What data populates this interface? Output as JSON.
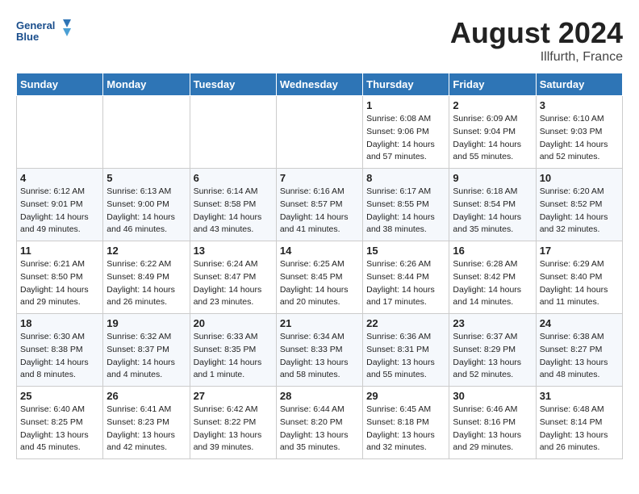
{
  "header": {
    "logo_line1": "General",
    "logo_line2": "Blue",
    "month": "August 2024",
    "location": "Illfurth, France"
  },
  "days_of_week": [
    "Sunday",
    "Monday",
    "Tuesday",
    "Wednesday",
    "Thursday",
    "Friday",
    "Saturday"
  ],
  "weeks": [
    [
      {
        "day": "",
        "info": ""
      },
      {
        "day": "",
        "info": ""
      },
      {
        "day": "",
        "info": ""
      },
      {
        "day": "",
        "info": ""
      },
      {
        "day": "1",
        "info": "Sunrise: 6:08 AM\nSunset: 9:06 PM\nDaylight: 14 hours\nand 57 minutes."
      },
      {
        "day": "2",
        "info": "Sunrise: 6:09 AM\nSunset: 9:04 PM\nDaylight: 14 hours\nand 55 minutes."
      },
      {
        "day": "3",
        "info": "Sunrise: 6:10 AM\nSunset: 9:03 PM\nDaylight: 14 hours\nand 52 minutes."
      }
    ],
    [
      {
        "day": "4",
        "info": "Sunrise: 6:12 AM\nSunset: 9:01 PM\nDaylight: 14 hours\nand 49 minutes."
      },
      {
        "day": "5",
        "info": "Sunrise: 6:13 AM\nSunset: 9:00 PM\nDaylight: 14 hours\nand 46 minutes."
      },
      {
        "day": "6",
        "info": "Sunrise: 6:14 AM\nSunset: 8:58 PM\nDaylight: 14 hours\nand 43 minutes."
      },
      {
        "day": "7",
        "info": "Sunrise: 6:16 AM\nSunset: 8:57 PM\nDaylight: 14 hours\nand 41 minutes."
      },
      {
        "day": "8",
        "info": "Sunrise: 6:17 AM\nSunset: 8:55 PM\nDaylight: 14 hours\nand 38 minutes."
      },
      {
        "day": "9",
        "info": "Sunrise: 6:18 AM\nSunset: 8:54 PM\nDaylight: 14 hours\nand 35 minutes."
      },
      {
        "day": "10",
        "info": "Sunrise: 6:20 AM\nSunset: 8:52 PM\nDaylight: 14 hours\nand 32 minutes."
      }
    ],
    [
      {
        "day": "11",
        "info": "Sunrise: 6:21 AM\nSunset: 8:50 PM\nDaylight: 14 hours\nand 29 minutes."
      },
      {
        "day": "12",
        "info": "Sunrise: 6:22 AM\nSunset: 8:49 PM\nDaylight: 14 hours\nand 26 minutes."
      },
      {
        "day": "13",
        "info": "Sunrise: 6:24 AM\nSunset: 8:47 PM\nDaylight: 14 hours\nand 23 minutes."
      },
      {
        "day": "14",
        "info": "Sunrise: 6:25 AM\nSunset: 8:45 PM\nDaylight: 14 hours\nand 20 minutes."
      },
      {
        "day": "15",
        "info": "Sunrise: 6:26 AM\nSunset: 8:44 PM\nDaylight: 14 hours\nand 17 minutes."
      },
      {
        "day": "16",
        "info": "Sunrise: 6:28 AM\nSunset: 8:42 PM\nDaylight: 14 hours\nand 14 minutes."
      },
      {
        "day": "17",
        "info": "Sunrise: 6:29 AM\nSunset: 8:40 PM\nDaylight: 14 hours\nand 11 minutes."
      }
    ],
    [
      {
        "day": "18",
        "info": "Sunrise: 6:30 AM\nSunset: 8:38 PM\nDaylight: 14 hours\nand 8 minutes."
      },
      {
        "day": "19",
        "info": "Sunrise: 6:32 AM\nSunset: 8:37 PM\nDaylight: 14 hours\nand 4 minutes."
      },
      {
        "day": "20",
        "info": "Sunrise: 6:33 AM\nSunset: 8:35 PM\nDaylight: 14 hours\nand 1 minute."
      },
      {
        "day": "21",
        "info": "Sunrise: 6:34 AM\nSunset: 8:33 PM\nDaylight: 13 hours\nand 58 minutes."
      },
      {
        "day": "22",
        "info": "Sunrise: 6:36 AM\nSunset: 8:31 PM\nDaylight: 13 hours\nand 55 minutes."
      },
      {
        "day": "23",
        "info": "Sunrise: 6:37 AM\nSunset: 8:29 PM\nDaylight: 13 hours\nand 52 minutes."
      },
      {
        "day": "24",
        "info": "Sunrise: 6:38 AM\nSunset: 8:27 PM\nDaylight: 13 hours\nand 48 minutes."
      }
    ],
    [
      {
        "day": "25",
        "info": "Sunrise: 6:40 AM\nSunset: 8:25 PM\nDaylight: 13 hours\nand 45 minutes."
      },
      {
        "day": "26",
        "info": "Sunrise: 6:41 AM\nSunset: 8:23 PM\nDaylight: 13 hours\nand 42 minutes."
      },
      {
        "day": "27",
        "info": "Sunrise: 6:42 AM\nSunset: 8:22 PM\nDaylight: 13 hours\nand 39 minutes."
      },
      {
        "day": "28",
        "info": "Sunrise: 6:44 AM\nSunset: 8:20 PM\nDaylight: 13 hours\nand 35 minutes."
      },
      {
        "day": "29",
        "info": "Sunrise: 6:45 AM\nSunset: 8:18 PM\nDaylight: 13 hours\nand 32 minutes."
      },
      {
        "day": "30",
        "info": "Sunrise: 6:46 AM\nSunset: 8:16 PM\nDaylight: 13 hours\nand 29 minutes."
      },
      {
        "day": "31",
        "info": "Sunrise: 6:48 AM\nSunset: 8:14 PM\nDaylight: 13 hours\nand 26 minutes."
      }
    ]
  ]
}
